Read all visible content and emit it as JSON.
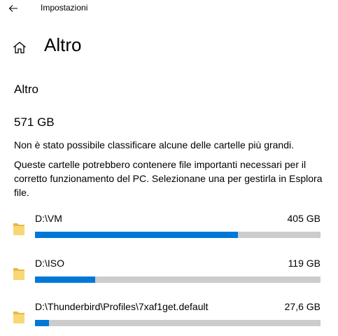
{
  "window": {
    "title": "Impostazioni"
  },
  "header": {
    "title": "Altro"
  },
  "section": {
    "title": "Altro",
    "total_size": "571 GB",
    "note1": "Non è stato possibile classificare alcune delle cartelle più grandi.",
    "note2": "Queste cartelle potrebbero contenere file importanti necessari per il corretto funzionamento del PC. Selezionane una per gestirla in Esplora file."
  },
  "folders": [
    {
      "name": "D:\\VM",
      "size": "405 GB",
      "usage_fraction": 0.71
    },
    {
      "name": "D:\\ISO",
      "size": "119 GB",
      "usage_fraction": 0.21
    },
    {
      "name": "D:\\Thunderbird\\Profiles\\7xaf1get.default",
      "size": "27,6 GB",
      "usage_fraction": 0.05
    }
  ],
  "colors": {
    "accent": "#0078d7",
    "track": "#cccccc",
    "folder": "#f8d775"
  },
  "icons": {
    "back": "back-arrow-icon",
    "home": "home-icon",
    "folder": "folder-icon"
  }
}
